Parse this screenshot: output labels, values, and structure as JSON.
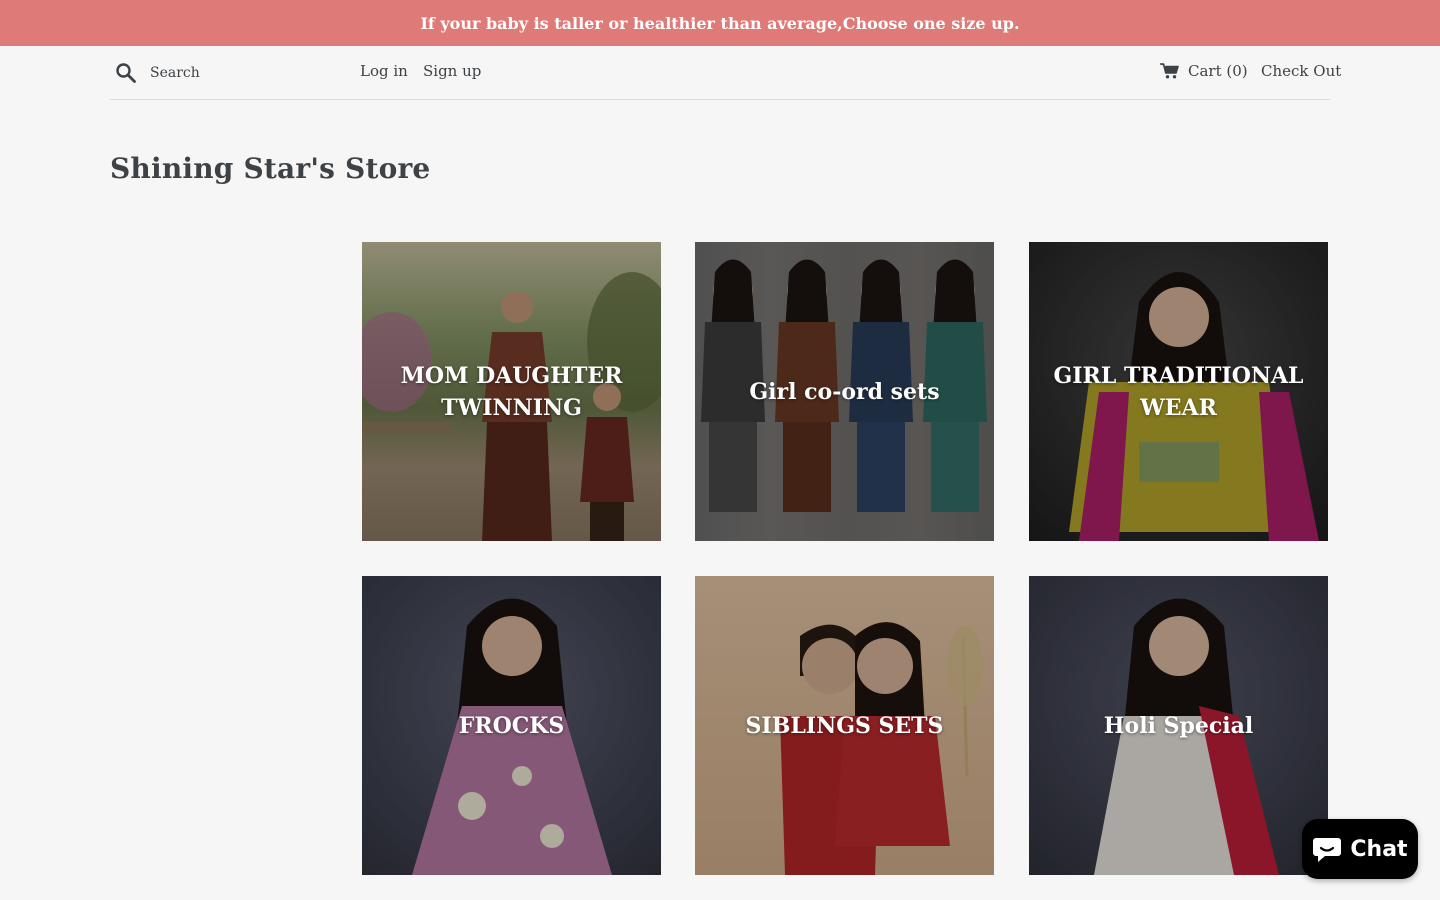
{
  "announcement": "If your baby is taller or healthier than average,Choose one size up.",
  "header": {
    "search_placeholder": "Search",
    "login": "Log in",
    "signup": "Sign up",
    "cart": "Cart (0)",
    "checkout": "Check Out"
  },
  "store_title": "Shining Star's Store",
  "collections": [
    {
      "title": "MOM DAUGHTER TWINNING"
    },
    {
      "title": "Girl co-ord sets"
    },
    {
      "title": "GIRL TRADITIONAL WEAR"
    },
    {
      "title": "FROCKS"
    },
    {
      "title": "SIBLINGS SETS"
    },
    {
      "title": "Holi Special"
    }
  ],
  "chat": {
    "label": "Chat"
  },
  "colors": {
    "announcement_bg": "#de7a77",
    "text": "#3d4246",
    "page_bg": "#f6f6f6"
  }
}
